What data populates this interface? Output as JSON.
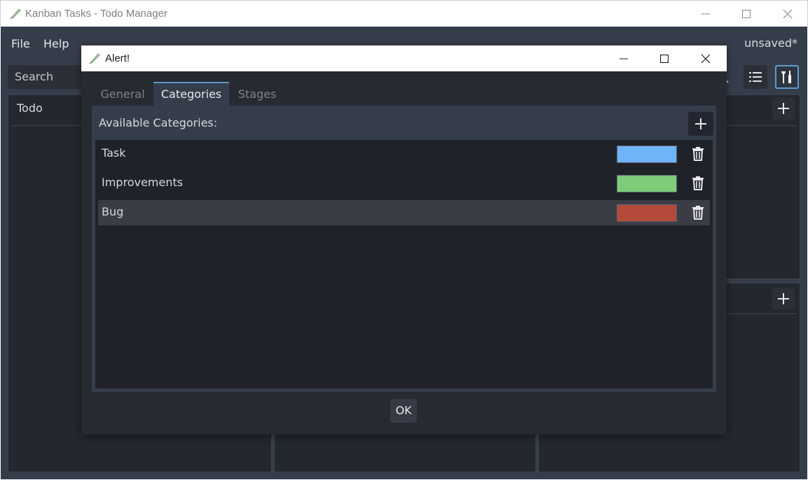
{
  "window": {
    "title": "Kanban Tasks - Todo Manager"
  },
  "menu": {
    "file": "File",
    "help": "Help",
    "status": "unsaved*"
  },
  "board": {
    "search_placeholder": "Search",
    "columns": [
      {
        "title": "Todo"
      }
    ]
  },
  "dialog": {
    "title": "Alert!",
    "tabs": [
      {
        "label": "General",
        "active": false
      },
      {
        "label": "Categories",
        "active": true
      },
      {
        "label": "Stages",
        "active": false
      }
    ],
    "header": "Available Categories:",
    "categories": [
      {
        "name": "Task",
        "color": "#6eb5f8",
        "selected": false
      },
      {
        "name": "Improvements",
        "color": "#7ecc7a",
        "selected": false
      },
      {
        "name": "Bug",
        "color": "#b54a3a",
        "selected": true
      }
    ],
    "ok_label": "OK"
  },
  "colors": {
    "accent": "#5e9ad0",
    "app_background": "#363d4a",
    "panel": "#2c313a",
    "list": "#1f2329"
  }
}
